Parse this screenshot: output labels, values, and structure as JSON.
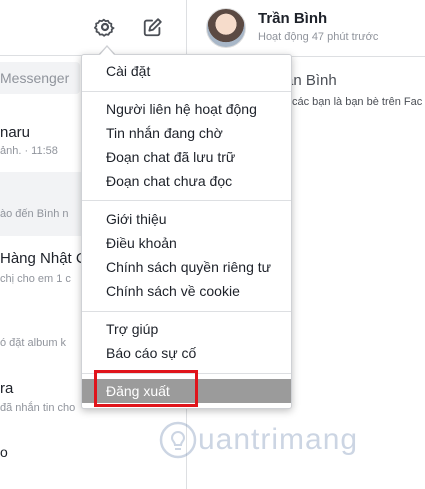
{
  "left": {
    "search_placeholder": "Messenger",
    "conversations": [
      {
        "name": "naru",
        "snippet": "ảnh. · 11:58"
      },
      {
        "name": "",
        "snippet": "ào đến Bình n"
      },
      {
        "name": "Hàng Nhật Cl",
        "snippet": "chị cho em 1 c"
      },
      {
        "name": "",
        "snippet": "ó đặt album k"
      },
      {
        "name": "ra",
        "snippet": "đã nhắn tin cho"
      }
    ],
    "edge_char": "o"
  },
  "chat": {
    "contact_name": "Trần Bình",
    "status": "Hoạt động 47 phút trước",
    "profile_name": "rần Bình",
    "profile_subtitle": "các bạn là bạn bè trên Fac"
  },
  "menu": {
    "groups": [
      [
        "Cài đặt"
      ],
      [
        "Người liên hệ hoạt động",
        "Tin nhắn đang chờ",
        "Đoạn chat đã lưu trữ",
        "Đoạn chat chưa đọc"
      ],
      [
        "Giới thiệu",
        "Điều khoản",
        "Chính sách quyền riêng tư",
        "Chính sách về cookie"
      ],
      [
        "Trợ giúp",
        "Báo cáo sự cố"
      ],
      [
        "Đăng xuất"
      ]
    ]
  },
  "watermark": "uantrimang",
  "colors": {
    "highlight": "#9b9b9b",
    "annotation_box": "#e0141b"
  }
}
